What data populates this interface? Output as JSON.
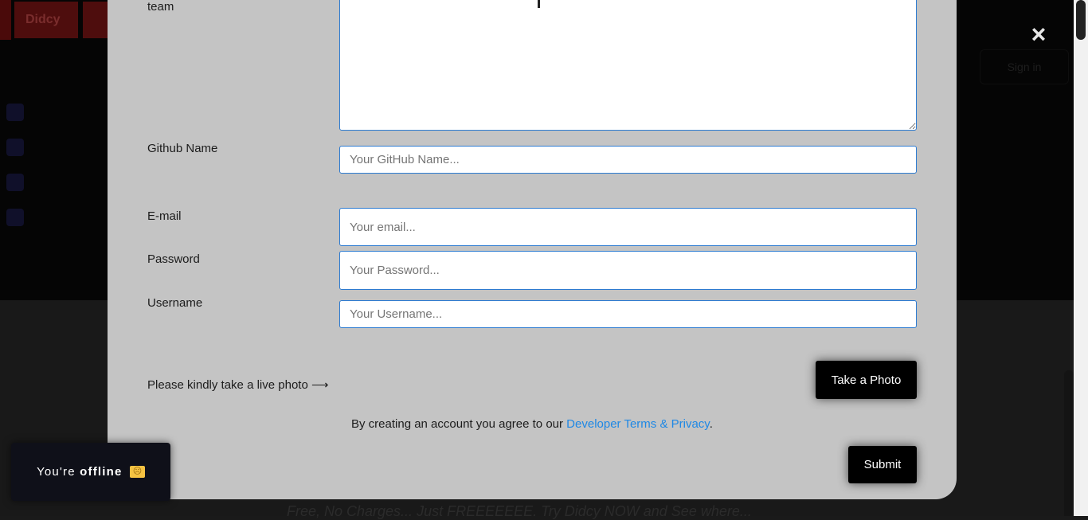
{
  "background": {
    "logo_text": "Didcy",
    "signin_label": "Sign in",
    "bottom_text": "Free, No Charges... Just FREEEEEEE. Try Didcy NOW and See where..."
  },
  "modal": {
    "close_icon": "×",
    "team_label": "team",
    "github": {
      "label": "Github Name",
      "placeholder": "Your GitHub Name..."
    },
    "email": {
      "label": "E-mail",
      "placeholder": "Your email..."
    },
    "password": {
      "label": "Password",
      "placeholder": "Your Password..."
    },
    "username": {
      "label": "Username",
      "placeholder": "Your Username..."
    },
    "photo": {
      "prompt": "Please kindly take a live photo ⟶",
      "button_label": "Take a Photo"
    },
    "agreement": {
      "prefix": "By creating an account you agree to our ",
      "link": "Developer Terms & Privacy",
      "suffix": "."
    },
    "submit_label": "Submit"
  },
  "toast": {
    "prefix": "You're ",
    "status": "offline",
    "emoji_icon": "sad-face-emoji"
  },
  "colors": {
    "modal_bg": "#c4c4c4",
    "input_border": "#2d7bd1",
    "link": "#1e88e5",
    "button_bg": "#000000",
    "toast_bg": "#0f1019"
  }
}
